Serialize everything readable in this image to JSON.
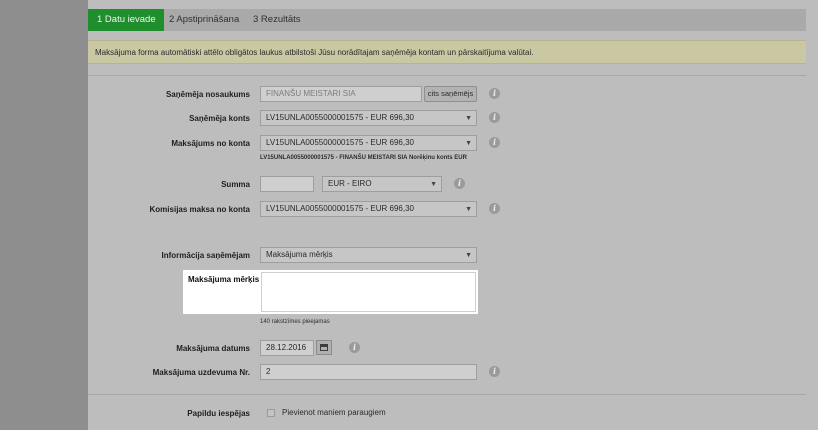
{
  "steps": [
    {
      "label": "1  Datu ievade"
    },
    {
      "label": "2  Apstiprināšana"
    },
    {
      "label": "3  Rezultāts"
    }
  ],
  "notice": "Maksājuma forma automātiski attēlo obligātos laukus atbilstoši Jūsu norādītajam saņēmēja kontam un pārskaitījuma valūtai.",
  "form": {
    "recipient_name_label": "Saņēmēja nosaukums",
    "recipient_name_value": "FINANŠU MEISTARI SIA",
    "other_recipient_button": "cits saņēmējs",
    "recipient_account_label": "Saņēmēja konts",
    "recipient_account_value": "LV15UNLA0055000001575 - EUR 696,30",
    "from_account_label": "Maksājums no konta",
    "from_account_value": "LV15UNLA0055000001575 - EUR 696,30",
    "from_account_note": "LV15UNLA0055000001575 - FINANŠU MEISTARI SIA Norēķinu konts EUR",
    "amount_label": "Summa",
    "amount_value": "",
    "currency_value": "EUR - EIRO",
    "commission_label": "Komisijas maksa no konta",
    "commission_value": "LV15UNLA0055000001575 - EUR 696,30",
    "info_to_recipient_label": "Informācija saņēmējam",
    "info_to_recipient_value": "Maksājuma mērķis",
    "purpose_label": "Maksājuma mērķis",
    "purpose_value": "",
    "chars_left": "140 rakstzīmes pieejamas",
    "date_label": "Maksājuma datums",
    "date_value": "28.12.2016",
    "order_no_label": "Maksājuma uzdevuma Nr.",
    "order_no_value": "2",
    "extra_options_label": "Papildu iespējas",
    "save_template_label": "Pievienot maniem paraugiem"
  },
  "icons": {
    "info": "i",
    "caret": "▼"
  }
}
